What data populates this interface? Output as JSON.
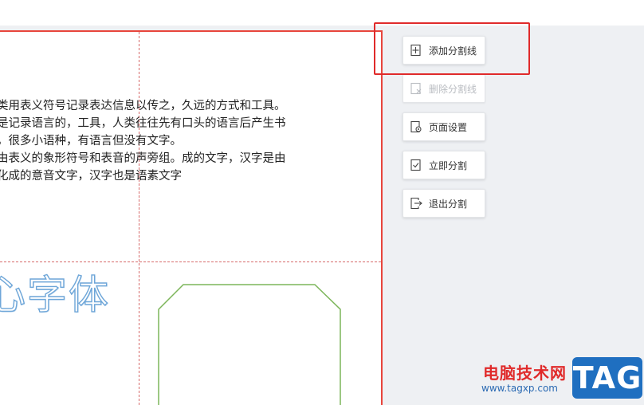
{
  "document": {
    "lines": [
      "类用表义符号记录表达信息以传之，久远的方式和工具。",
      "是记录语言的，工具，人类往往先有口头的语言后产生书",
      "，很多小语种，有语言但没有文字。",
      "由表义的象形符号和表音的声旁组。成的文字，汉字是由",
      "化成的意音文字，汉字也是语素文字"
    ],
    "art_text": "心字体"
  },
  "panel": {
    "add_split": "添加分割线",
    "delete_split": "删除分割线",
    "page_setup": "页面设置",
    "split_now": "立即分割",
    "exit_split": "退出分割"
  },
  "watermark": {
    "title": "电脑技术网",
    "url": "www.tagxp.com",
    "tag": "TAG"
  },
  "colors": {
    "accent_red": "#e02a2a",
    "split_line": "#d76b6b",
    "shape_green": "#7cb55a",
    "art_text_blue": "#6ea6d8"
  }
}
